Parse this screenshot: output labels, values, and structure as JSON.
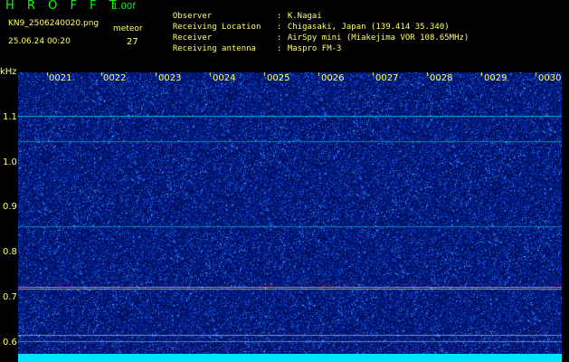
{
  "header": {
    "title": "H R O F F T",
    "version": "1.00f",
    "filename": "KN9_2506240020.png",
    "timestamp": "25.06.24 00:20",
    "meteor_label": "meteor",
    "meteor_count": "27"
  },
  "info": [
    {
      "key": "Observer",
      "sep": ":",
      "value": "K.Nagai"
    },
    {
      "key": "Receiving Location",
      "sep": ":",
      "value": "Chigasaki, Japan (139.414 35.340)"
    },
    {
      "key": "Receiver",
      "sep": ":",
      "value": "AirSpy mini (Miakejima VOR 108.65MHz)"
    },
    {
      "key": "Receiving antenna",
      "sep": ":",
      "value": "Maspro FM-3"
    }
  ],
  "yaxis": {
    "unit": "kHz",
    "ticks": [
      "1.1",
      "1.0",
      "0.9",
      "0.8",
      "0.7",
      "0.6"
    ]
  },
  "xaxis": {
    "ticks": [
      "0021",
      "0022",
      "0023",
      "0024",
      "0025",
      "0026",
      "0027",
      "0028",
      "0029",
      "0030"
    ]
  },
  "colors": {
    "background": "#001060",
    "label": "#ffff66",
    "title": "#00ff00",
    "carrier": "#ff8040",
    "trace": "#00e0e0"
  }
}
